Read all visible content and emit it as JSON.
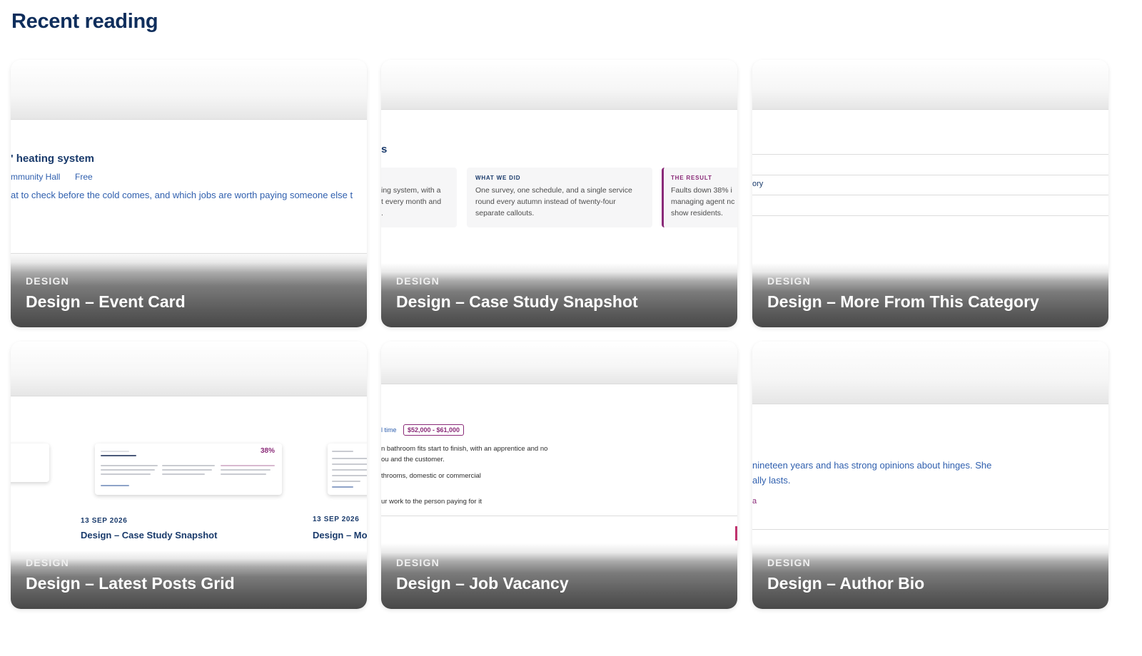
{
  "section": {
    "title": "Recent reading"
  },
  "cards": [
    {
      "category": "DESIGN",
      "title": "Design – Event Card",
      "preview": {
        "heading": "' heating system",
        "meta_venue": "mmunity Hall",
        "meta_price": "Free",
        "body": "at to check before the cold comes, and which jobs are worth paying someone else t"
      }
    },
    {
      "category": "DESIGN",
      "title": "Design – Case Study Snapshot",
      "preview": {
        "heading": "s",
        "col1_lines": [
          "ing system, with a",
          "t every month and",
          "."
        ],
        "col2_label": "WHAT WE DID",
        "col2_lines": [
          "One survey, one schedule, and a single service",
          "round every autumn instead of twenty-four",
          "separate callouts."
        ],
        "col3_label": "THE RESULT",
        "col3_lines": [
          "Faults down 38% i",
          "managing agent nc",
          "show residents."
        ]
      }
    },
    {
      "category": "DESIGN",
      "title": "Design – More From This Category",
      "preview": {
        "fragment": "ory"
      }
    },
    {
      "category": "DESIGN",
      "title": "Design – Latest Posts Grid",
      "preview": {
        "mini_stat": "38%",
        "post1_date": "13 SEP 2026",
        "post1_title": "Design – Case Study Snapshot",
        "post2_date": "13 SEP 2026",
        "post2_title": "Design – Mor"
      }
    },
    {
      "category": "DESIGN",
      "title": "Design – Job Vacancy",
      "preview": {
        "tag_time": "l time",
        "tag_salary": "$52,000 - $61,000",
        "line1": "n bathroom fits start to finish, with an apprentice and no",
        "line2": "ou and the customer.",
        "line3": "throoms, domestic or commercial",
        "line4": "ur work to the person paying for it"
      }
    },
    {
      "category": "DESIGN",
      "title": "Design – Author Bio",
      "preview": {
        "line1": "nineteen years and has strong opinions about hinges. She",
        "line2": "ally lasts.",
        "line3": "a"
      }
    }
  ]
}
